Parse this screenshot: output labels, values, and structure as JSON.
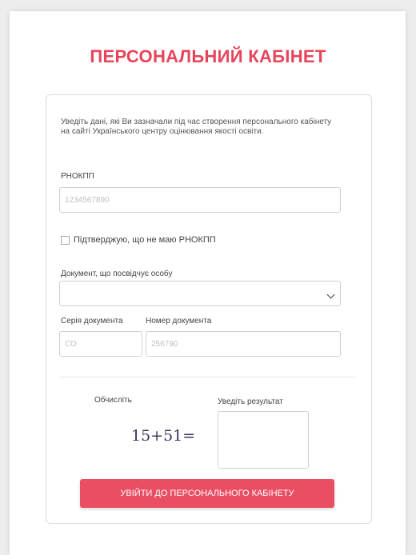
{
  "page": {
    "title": "ПЕРСОНАЛЬНИЙ КАБІНЕТ",
    "intro": "Уведіть дані, які Ви зазначали під час створення персонального кабінету на сайті Українського центру оцінювання якості освіти."
  },
  "form": {
    "rnokpp_label": "РНОКПП",
    "rnokpp_placeholder": "1234567890",
    "no_rnokpp_label": "Підтверджую, що не маю РНОКПП",
    "document_label": "Документ, що посвідчує особу",
    "series_label": "Серія документа",
    "series_placeholder": "СО",
    "number_label": "Номер документа",
    "number_placeholder": "256790",
    "compute_label": "Обчисліть",
    "captcha_text": "15+51=",
    "result_label": "Уведіть результат",
    "submit_label": "УВІЙТИ ДО ПЕРСОНАЛЬНОГО КАБІНЕТУ"
  }
}
